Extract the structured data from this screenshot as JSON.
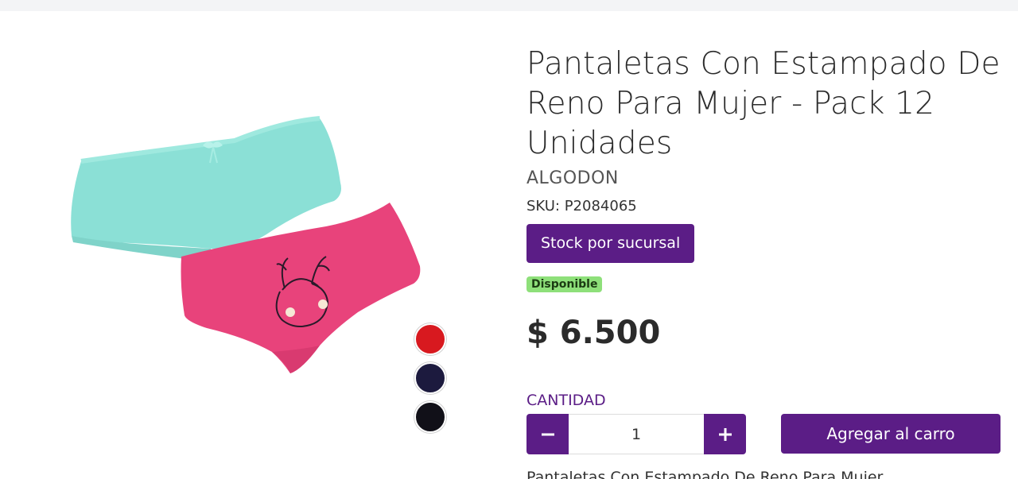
{
  "product": {
    "title": "Pantaletas Con Estampado De Reno Para Mujer - Pack 12 Unidades",
    "brand": "ALGODON",
    "sku": "SKU: P2084065",
    "stock_button": "Stock por sucursal",
    "availability": "Disponible",
    "price": "$ 6.500",
    "description_preview": "Pantaletas Con Estampado De Reno Para Mujer"
  },
  "swatches": [
    {
      "name": "red",
      "color": "#d8191f"
    },
    {
      "name": "navy",
      "color": "#1c1a3e"
    },
    {
      "name": "black",
      "color": "#111018"
    }
  ],
  "quantity": {
    "label": "CANTIDAD",
    "value": "1",
    "minus": "−",
    "plus": "+"
  },
  "cart": {
    "button_label": "Agregar al carro"
  },
  "colors": {
    "accent": "#5b1d86",
    "available_badge": "#8ee07a"
  }
}
